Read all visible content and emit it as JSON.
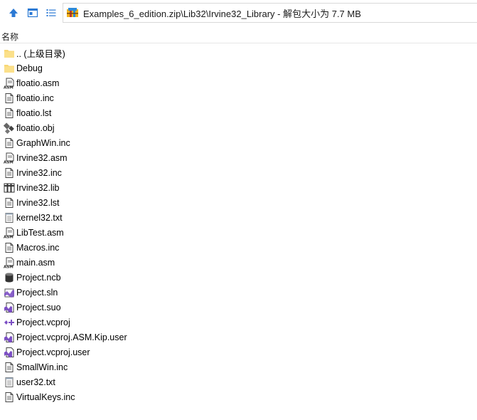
{
  "toolbar": {
    "up_icon": "arrow-up-icon",
    "view_icon": "window-view-icon",
    "list_icon": "list-view-icon"
  },
  "address": {
    "icon": "zip-archive-icon",
    "path": "Examples_6_edition.zip\\Lib32\\Irvine32_Library - 解包大小为 7.7 MB"
  },
  "columns": {
    "name": "名称"
  },
  "files": [
    {
      "name": ".. (上级目录)",
      "icon": "folder-icon"
    },
    {
      "name": "Debug",
      "icon": "folder-icon"
    },
    {
      "name": "floatio.asm",
      "icon": "asm-file-icon"
    },
    {
      "name": "floatio.inc",
      "icon": "text-file-icon"
    },
    {
      "name": "floatio.lst",
      "icon": "text-file-icon"
    },
    {
      "name": "floatio.obj",
      "icon": "object-file-icon"
    },
    {
      "name": "GraphWin.inc",
      "icon": "text-file-icon"
    },
    {
      "name": "Irvine32.asm",
      "icon": "asm-file-icon"
    },
    {
      "name": "Irvine32.inc",
      "icon": "text-file-icon"
    },
    {
      "name": "Irvine32.lib",
      "icon": "library-file-icon"
    },
    {
      "name": "Irvine32.lst",
      "icon": "text-file-icon"
    },
    {
      "name": "kernel32.txt",
      "icon": "notepad-file-icon"
    },
    {
      "name": "LibTest.asm",
      "icon": "asm-file-icon"
    },
    {
      "name": "Macros.inc",
      "icon": "text-file-icon"
    },
    {
      "name": "main.asm",
      "icon": "asm-file-icon"
    },
    {
      "name": "Project.ncb",
      "icon": "database-file-icon"
    },
    {
      "name": "Project.sln",
      "icon": "vs-solution-icon"
    },
    {
      "name": "Project.suo",
      "icon": "vs-file-icon"
    },
    {
      "name": "Project.vcproj",
      "icon": "vcproj-icon"
    },
    {
      "name": "Project.vcproj.ASM.Kip.user",
      "icon": "vs-file-icon"
    },
    {
      "name": "Project.vcproj.user",
      "icon": "vs-file-icon"
    },
    {
      "name": "SmallWin.inc",
      "icon": "text-file-icon"
    },
    {
      "name": "user32.txt",
      "icon": "notepad-file-icon"
    },
    {
      "name": "VirtualKeys.inc",
      "icon": "text-file-icon"
    }
  ]
}
